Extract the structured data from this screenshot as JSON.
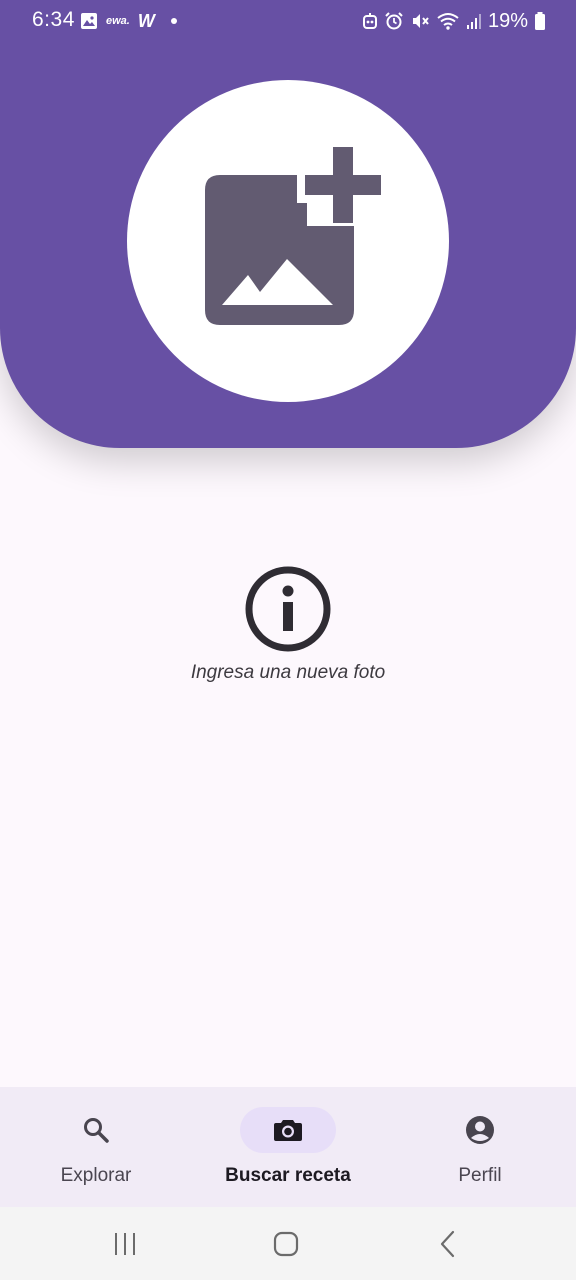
{
  "status_bar": {
    "time": "6:34",
    "notification_icons": [
      "image-icon",
      "ewa-app-icon",
      "w-app-icon",
      "dot-icon"
    ],
    "ewa_label": "ewa.",
    "w_label": "W",
    "system_icons": [
      "robot-icon",
      "alarm-icon",
      "mute-icon",
      "wifi-icon",
      "signal-icon"
    ],
    "battery": "19%"
  },
  "header": {
    "background_color": "#6750a4",
    "add_photo_icon": "add-photo-icon"
  },
  "main": {
    "info_icon": "info-icon",
    "empty_message": "Ingresa una nueva foto"
  },
  "bottom_nav": {
    "items": [
      {
        "label": "Explorar",
        "icon": "search-icon",
        "active": false
      },
      {
        "label": "Buscar receta",
        "icon": "camera-icon",
        "active": true
      },
      {
        "label": "Perfil",
        "icon": "account-circle-icon",
        "active": false
      }
    ]
  },
  "system_nav": {
    "buttons": [
      "recents-icon",
      "home-icon",
      "back-icon"
    ]
  }
}
